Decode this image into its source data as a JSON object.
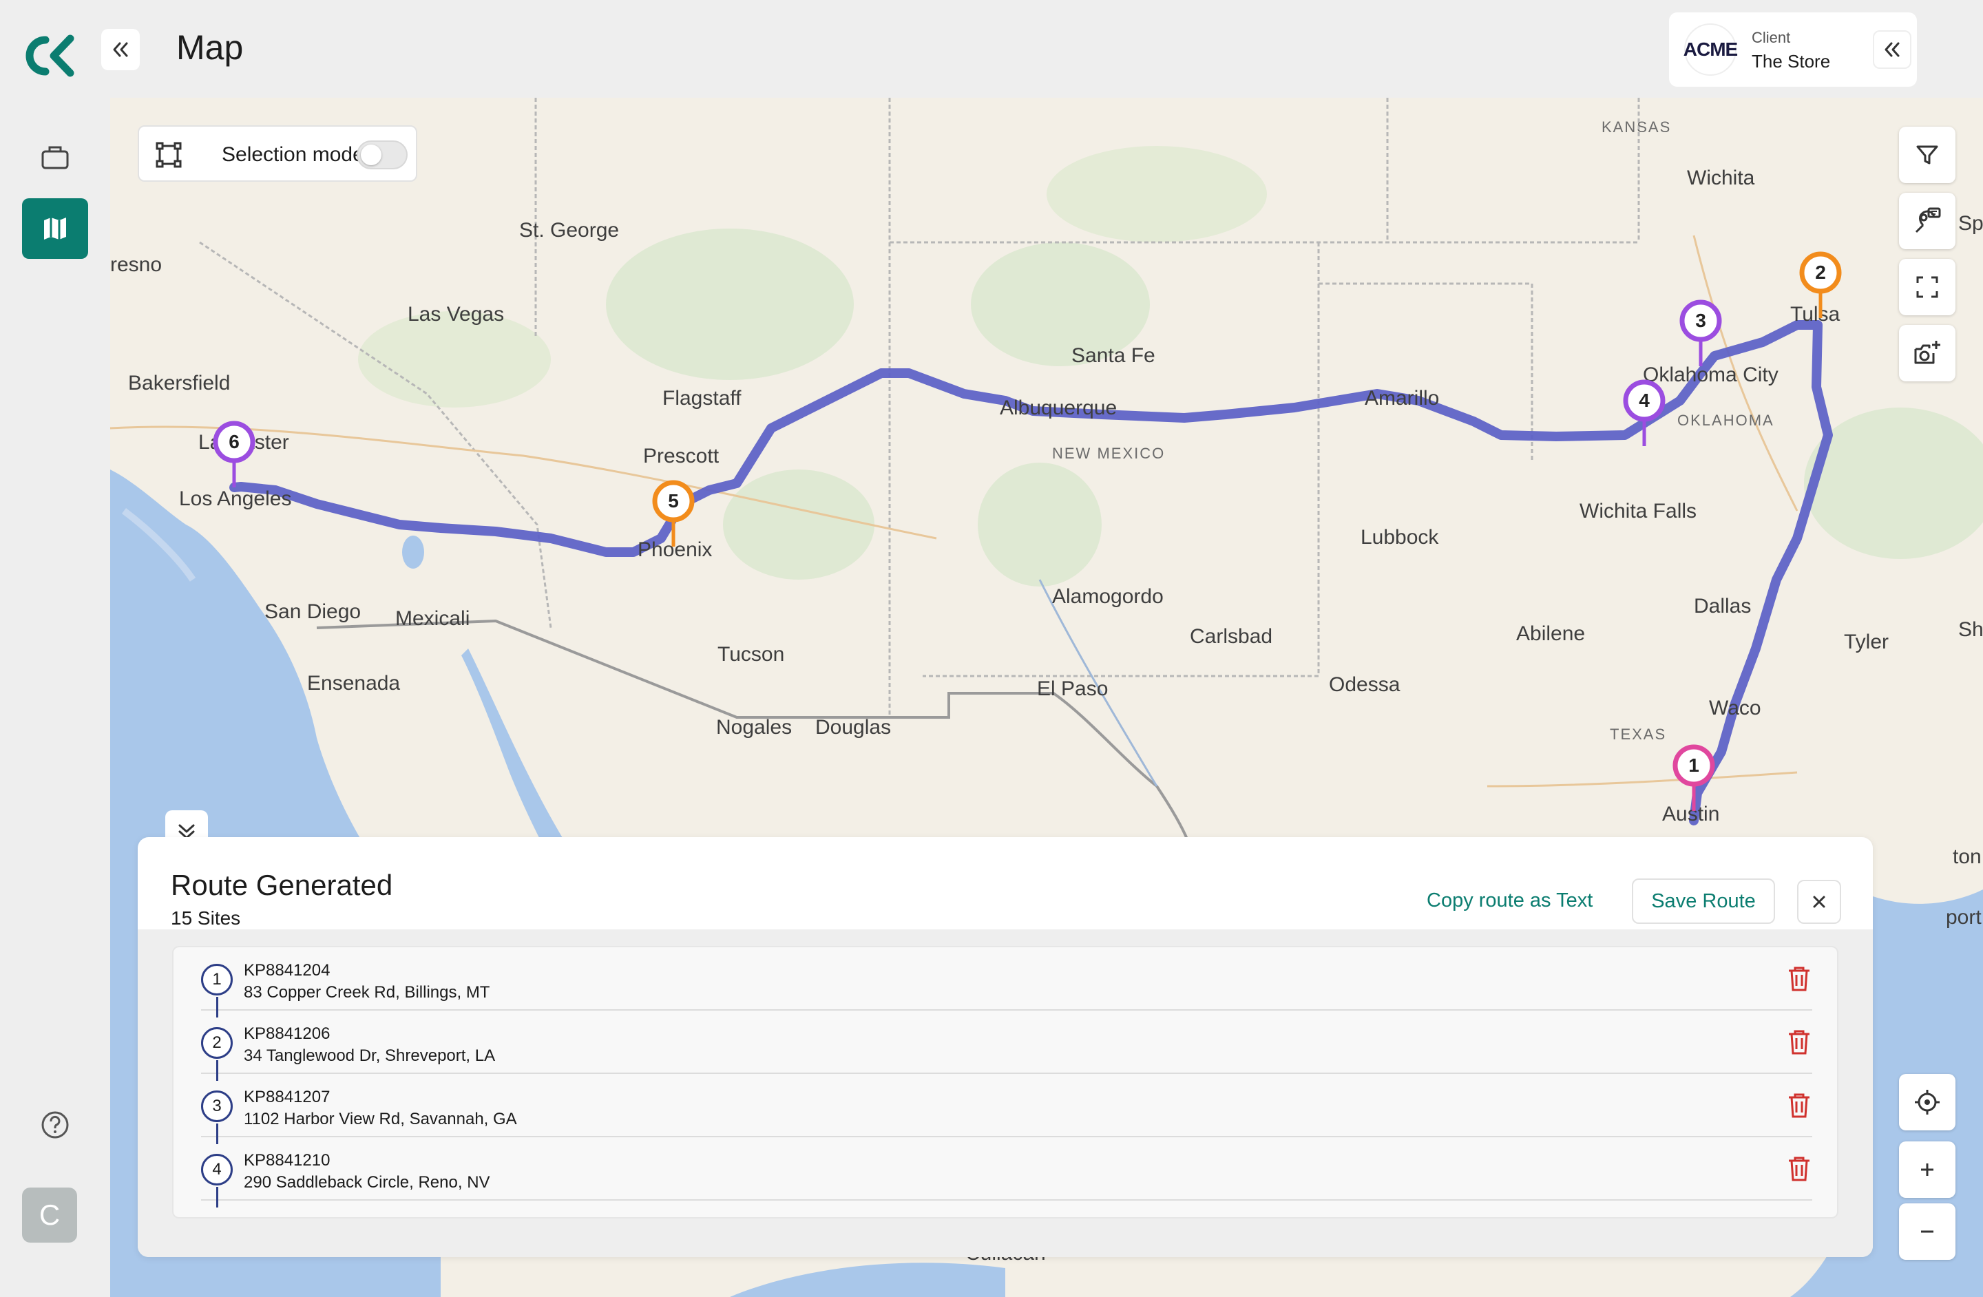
{
  "app": {
    "page_title": "Map",
    "avatar_initial": "C",
    "brand_color": "#0b7d70"
  },
  "client": {
    "logo_text": "ACME",
    "label": "Client",
    "name": "The Store"
  },
  "map": {
    "selection_mode_label": "Selection mode",
    "selection_mode_on": false,
    "route_color": "#5b5fc7",
    "labels": [
      {
        "text": "KANSAS",
        "kind": "state"
      },
      {
        "text": "Wichita",
        "kind": "city"
      },
      {
        "text": "St. George",
        "kind": "city"
      },
      {
        "text": "resno",
        "kind": "city"
      },
      {
        "text": "Las Vegas",
        "kind": "city"
      },
      {
        "text": "Tulsa",
        "kind": "city"
      },
      {
        "text": "Santa Fe",
        "kind": "city"
      },
      {
        "text": "Oklahoma City",
        "kind": "city"
      },
      {
        "text": "Bakersfield",
        "kind": "city"
      },
      {
        "text": "Flagstaff",
        "kind": "city"
      },
      {
        "text": "Albuquerque",
        "kind": "city"
      },
      {
        "text": "Amarillo",
        "kind": "city"
      },
      {
        "text": "OKLAHOMA",
        "kind": "state"
      },
      {
        "text": "Lancaster",
        "kind": "city"
      },
      {
        "text": "NEW MEXICO",
        "kind": "state"
      },
      {
        "text": "Prescott",
        "kind": "city"
      },
      {
        "text": "Los Angeles",
        "kind": "city"
      },
      {
        "text": "Wichita Falls",
        "kind": "city"
      },
      {
        "text": "Phoenix",
        "kind": "city"
      },
      {
        "text": "Lubbock",
        "kind": "city"
      },
      {
        "text": "Alamogordo",
        "kind": "city"
      },
      {
        "text": "Dallas",
        "kind": "city"
      },
      {
        "text": "San Diego",
        "kind": "city"
      },
      {
        "text": "Mexicali",
        "kind": "city"
      },
      {
        "text": "Shreve",
        "kind": "city"
      },
      {
        "text": "Abilene",
        "kind": "city"
      },
      {
        "text": "Carlsbad",
        "kind": "city"
      },
      {
        "text": "Tyler",
        "kind": "city"
      },
      {
        "text": "Tucson",
        "kind": "city"
      },
      {
        "text": "Ensenada",
        "kind": "city"
      },
      {
        "text": "Odessa",
        "kind": "city"
      },
      {
        "text": "El Paso",
        "kind": "city"
      },
      {
        "text": "Waco",
        "kind": "city"
      },
      {
        "text": "Nogales",
        "kind": "city"
      },
      {
        "text": "Douglas",
        "kind": "city"
      },
      {
        "text": "TEXAS",
        "kind": "state"
      },
      {
        "text": "Austin",
        "kind": "city"
      },
      {
        "text": "Sp",
        "kind": "city"
      },
      {
        "text": "ton",
        "kind": "city"
      },
      {
        "text": "port",
        "kind": "city"
      },
      {
        "text": "Culiacan",
        "kind": "city"
      }
    ],
    "pins": [
      {
        "number": "1",
        "color": "#e0479e"
      },
      {
        "number": "2",
        "color": "#f28c1c"
      },
      {
        "number": "3",
        "color": "#9b4de0"
      },
      {
        "number": "4",
        "color": "#9b4de0"
      },
      {
        "number": "5",
        "color": "#f28c1c"
      },
      {
        "number": "6",
        "color": "#9b4de0"
      }
    ],
    "controls": [
      "filter-icon",
      "map-pin-settings-icon",
      "fullscreen-icon",
      "camera-add-icon",
      "locate-icon",
      "zoom-in-icon",
      "zoom-out-icon"
    ]
  },
  "route_panel": {
    "title": "Route Generated",
    "subtitle": "15 Sites",
    "copy_label": "Copy route as Text",
    "save_label": "Save Route",
    "sites": [
      {
        "step": "1",
        "id": "KP8841204",
        "address": "83 Copper Creek Rd, Billings, MT"
      },
      {
        "step": "2",
        "id": "KP8841206",
        "address": "34 Tanglewood Dr, Shreveport, LA"
      },
      {
        "step": "3",
        "id": "KP8841207",
        "address": "1102 Harbor View Rd, Savannah, GA"
      },
      {
        "step": "4",
        "id": "KP8841210",
        "address": "290 Saddleback Circle, Reno, NV"
      }
    ]
  }
}
